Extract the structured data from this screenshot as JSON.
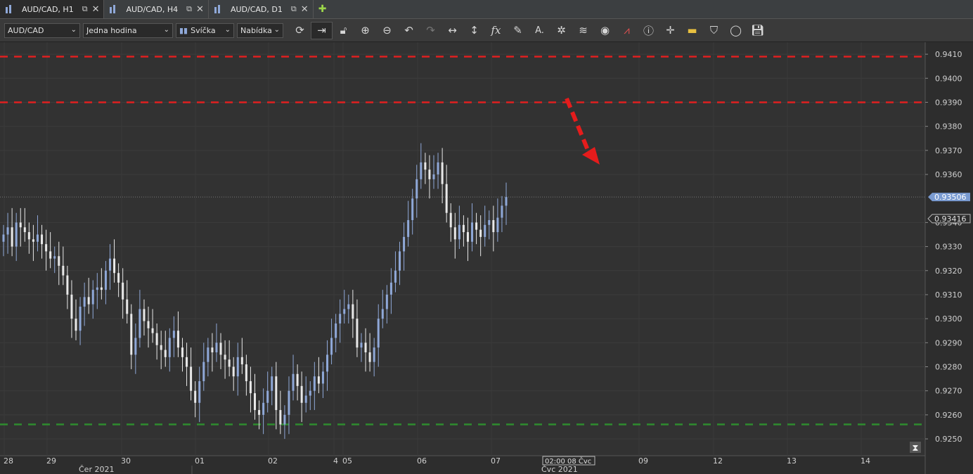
{
  "tabs": [
    {
      "label": "AUD/CAD, H1",
      "active": true
    },
    {
      "label": "AUD/CAD, H4",
      "active": false
    },
    {
      "label": "AUD/CAD, D1",
      "active": false
    }
  ],
  "toolbar": {
    "symbol": "AUD/CAD",
    "timeframe": "Jedna hodina",
    "chart_type": "Svíčka",
    "offer_side": "Nabídka",
    "icons": [
      "refresh-icon",
      "shift-chart-icon",
      "lock-icon",
      "zoom-in-icon",
      "zoom-out-icon",
      "undo-icon",
      "redo-icon",
      "horizontal-scale-icon",
      "vertical-scale-icon",
      "indicators-fx-icon",
      "pencil-draw-icon",
      "text-tool-icon",
      "crosshair-star-icon",
      "layers-icon",
      "eye-icon",
      "pattern-icon",
      "info-icon",
      "cursor-cross-icon",
      "ruler-icon",
      "fill-bucket-icon",
      "circle-icon",
      "save-icon"
    ]
  },
  "chart_data": {
    "type": "candlestick",
    "y_ticks": [
      "0.9410",
      "0.9400",
      "0.9390",
      "0.9380",
      "0.9370",
      "0.9360",
      "0.9340",
      "0.9330",
      "0.9320",
      "0.9310",
      "0.9300",
      "0.9290",
      "0.9280",
      "0.9270",
      "0.9260",
      "0.9250"
    ],
    "ylim": [
      0.9243,
      0.9415
    ],
    "current_bid": "0.93506",
    "current_ask": "0.93416",
    "x_day_labels": [
      "28",
      "29",
      "30",
      "01",
      "02",
      "4",
      "05",
      "06",
      "07",
      "09",
      "12",
      "13",
      "14"
    ],
    "x_cursor_label": "02:00 08 Čvc",
    "x_month_labels": [
      "Čer 2021",
      "Čvc 2021"
    ],
    "horizontal_lines": [
      {
        "price": 0.9409,
        "color": "#e02020",
        "style": "dashed"
      },
      {
        "price": 0.939,
        "color": "#e02020",
        "style": "dashed"
      },
      {
        "price": 0.9256,
        "color": "#2e8b2e",
        "style": "dashed"
      }
    ],
    "candles_close_path": [
      0.9335,
      0.9338,
      0.933,
      0.934,
      0.9338,
      0.9336,
      0.9333,
      0.9332,
      0.9335,
      0.9331,
      0.9328,
      0.9325,
      0.9326,
      0.9322,
      0.9318,
      0.931,
      0.93,
      0.9295,
      0.9305,
      0.9309,
      0.9306,
      0.9312,
      0.9313,
      0.9312,
      0.932,
      0.9325,
      0.9319,
      0.9315,
      0.9308,
      0.9302,
      0.9285,
      0.9292,
      0.9304,
      0.9299,
      0.9296,
      0.9294,
      0.9289,
      0.9287,
      0.9284,
      0.9292,
      0.9295,
      0.9288,
      0.9284,
      0.928,
      0.927,
      0.9265,
      0.9274,
      0.9282,
      0.9288,
      0.9286,
      0.929,
      0.9285,
      0.9283,
      0.928,
      0.9276,
      0.9284,
      0.9281,
      0.9274,
      0.9269,
      0.9262,
      0.926,
      0.9265,
      0.927,
      0.9276,
      0.9262,
      0.9256,
      0.926,
      0.927,
      0.9277,
      0.9272,
      0.9265,
      0.9268,
      0.927,
      0.9276,
      0.9273,
      0.9278,
      0.9285,
      0.9292,
      0.9298,
      0.9302,
      0.9304,
      0.9306,
      0.93,
      0.9288,
      0.929,
      0.9286,
      0.9282,
      0.9288,
      0.93,
      0.9304,
      0.931,
      0.9315,
      0.932,
      0.9328,
      0.9334,
      0.9341,
      0.935,
      0.9358,
      0.9365,
      0.9362,
      0.9358,
      0.936,
      0.9365,
      0.9356,
      0.9344,
      0.9338,
      0.9333,
      0.9339,
      0.9336,
      0.9332,
      0.934,
      0.9337,
      0.9334,
      0.9339,
      0.9341,
      0.9336,
      0.9342,
      0.9347,
      0.93506
    ]
  }
}
